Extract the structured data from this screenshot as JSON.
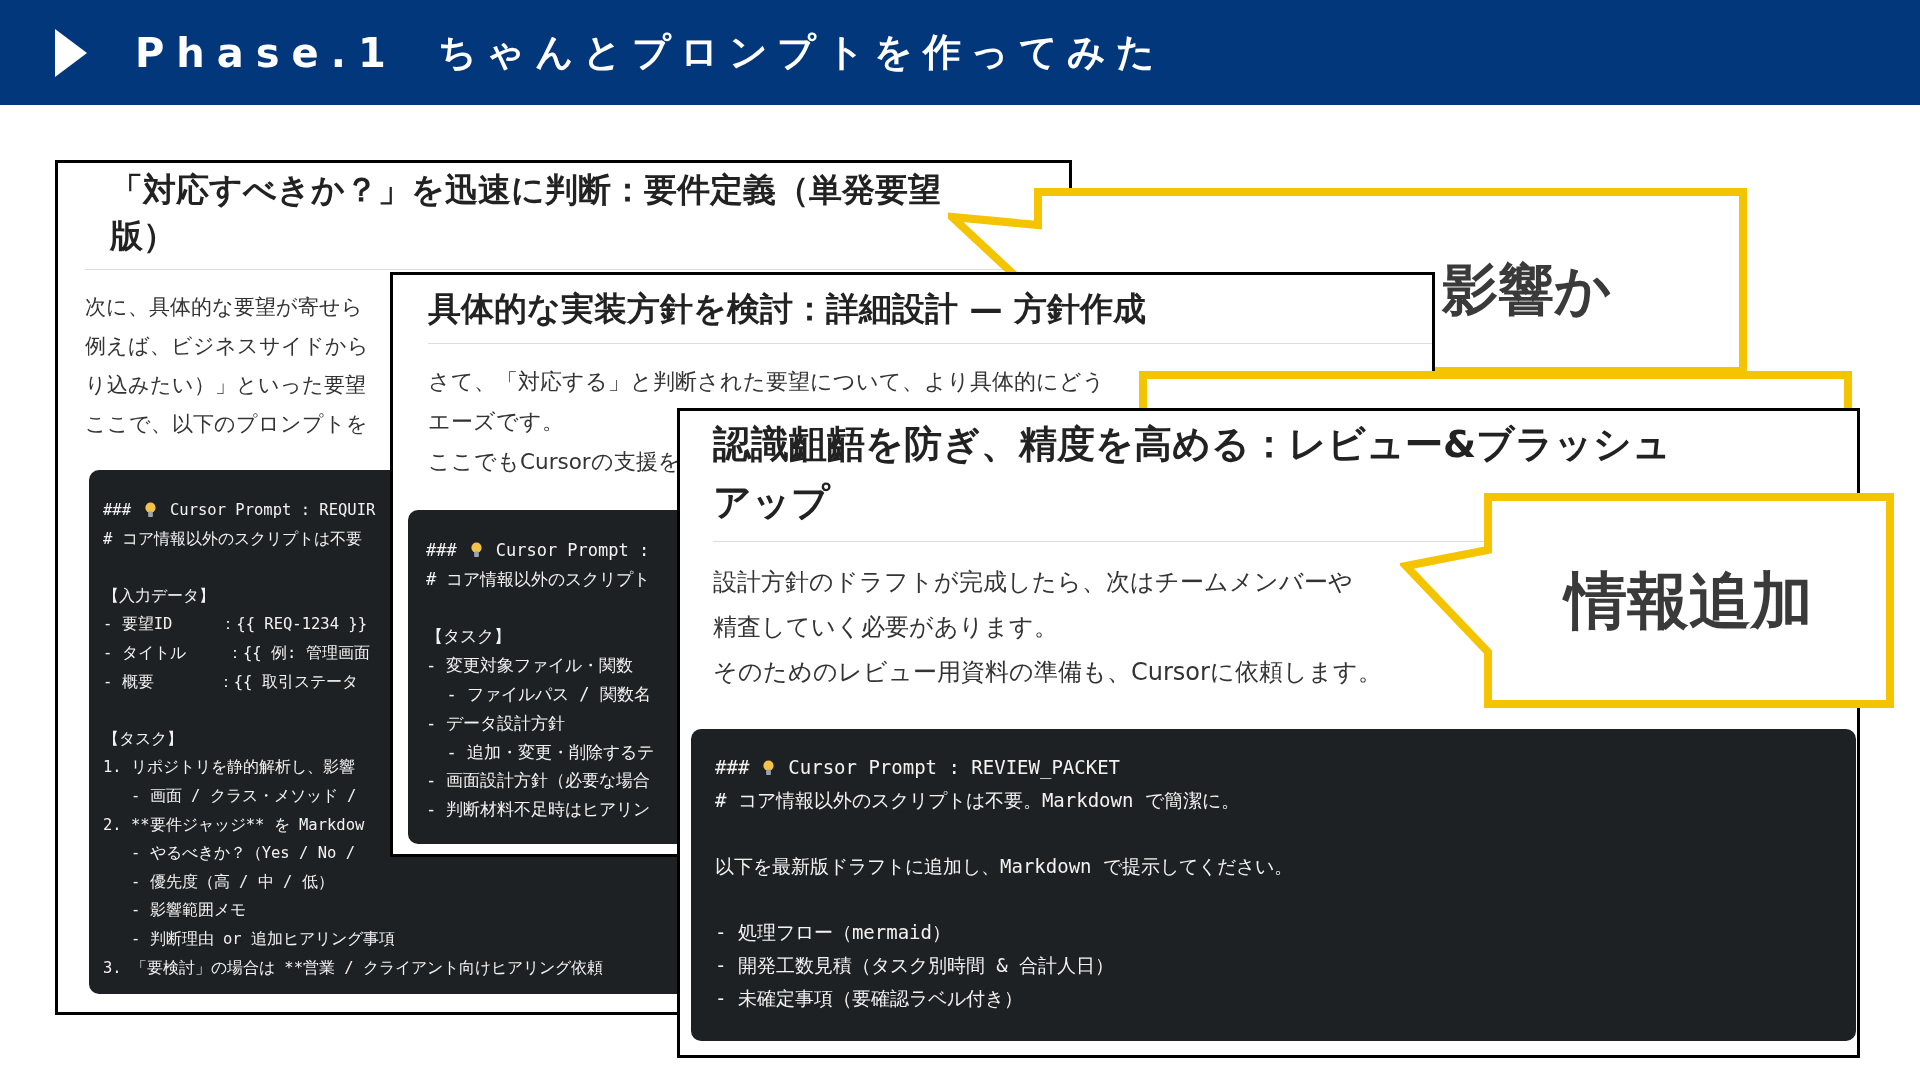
{
  "header": {
    "phase": "Phase.1",
    "title": "ちゃんとプロンプトを作ってみた"
  },
  "cards": [
    {
      "title_lines": [
        "「対応すべきか？」を迅速に判断：要件定義（単発要望",
        "版）"
      ],
      "paragraphs": [
        [
          "次に、具体的な要望が寄せら",
          "例えば、ビジネスサイドから",
          "り込みたい）」といった要望",
          "ここで、以下のプロンプトを"
        ]
      ],
      "code": {
        "prefix": "###",
        "heading": "Cursor Prompt : REQUIR",
        "blocks": [
          [
            "# コア情報以外のスクリプトは不要"
          ],
          [
            "【入力データ】",
            "- 要望ID　　　：{{ REQ-1234 }}",
            "- タイトル　　 ：{{ 例: 管理画面",
            "- 概要　　　　：{{ 取引ステータ"
          ],
          [
            "【タスク】",
            "1. リポジトリを静的解析し、影響",
            "   - 画面 / クラス・メソッド /",
            "2. **要件ジャッジ** を Markdow",
            "   - やるべきか？（Yes / No /",
            "   - 優先度（高 / 中 / 低）",
            "   - 影響範囲メモ",
            "   - 判断理由 or 追加ヒアリング事項",
            "3. 「要検討」の場合は **営業 / クライアント向けヒアリング依頼"
          ]
        ]
      }
    },
    {
      "title_lines": [
        "具体的な実装方針を検討：詳細設計 — 方針作成"
      ],
      "paragraphs": [
        [
          "さて、「対応する」と判断された要望について、より具体的にどう",
          "エーズです。"
        ],
        [
          "ここでもCursorの支援を"
        ]
      ],
      "code": {
        "prefix": "###",
        "heading": "Cursor Prompt :",
        "blocks": [
          [
            "# コア情報以外のスクリプト"
          ],
          [
            "【タスク】",
            "- 変更対象ファイル・関数",
            "  - ファイルパス / 関数名",
            "- データ設計方針",
            "  - 追加・変更・削除するテ",
            "- 画面設計方針（必要な場合",
            "- 判断材料不足時はヒアリン"
          ]
        ]
      }
    },
    {
      "title_lines": [
        "認識齟齬を防ぎ、精度を高める：レビュー&ブラッシュ",
        "アップ"
      ],
      "paragraphs": [
        [
          "設計方針のドラフトが完成したら、次はチームメンバーや",
          "精査していく必要があります。"
        ],
        [
          "そのためのレビュー用資料の準備も、Cursorに依頼します。"
        ]
      ],
      "code": {
        "prefix": "###",
        "heading": "Cursor Prompt : REVIEW_PACKET",
        "blocks": [
          [
            "# コア情報以外のスクリプトは不要。Markdown で簡潔に。"
          ],
          [
            "以下を最新版ドラフトに追加し、Markdown で提示してください。"
          ],
          [
            "- 処理フロー（mermaid）",
            "- 開発工数見積（タスク別時間 & 合計人日）",
            "- 未確定事項（要確認ラベル付き）"
          ]
        ]
      }
    }
  ],
  "callouts": [
    {
      "kind": "text",
      "text": "影響か"
    },
    {
      "kind": "blank"
    },
    {
      "kind": "text",
      "text": "情報追加"
    }
  ]
}
